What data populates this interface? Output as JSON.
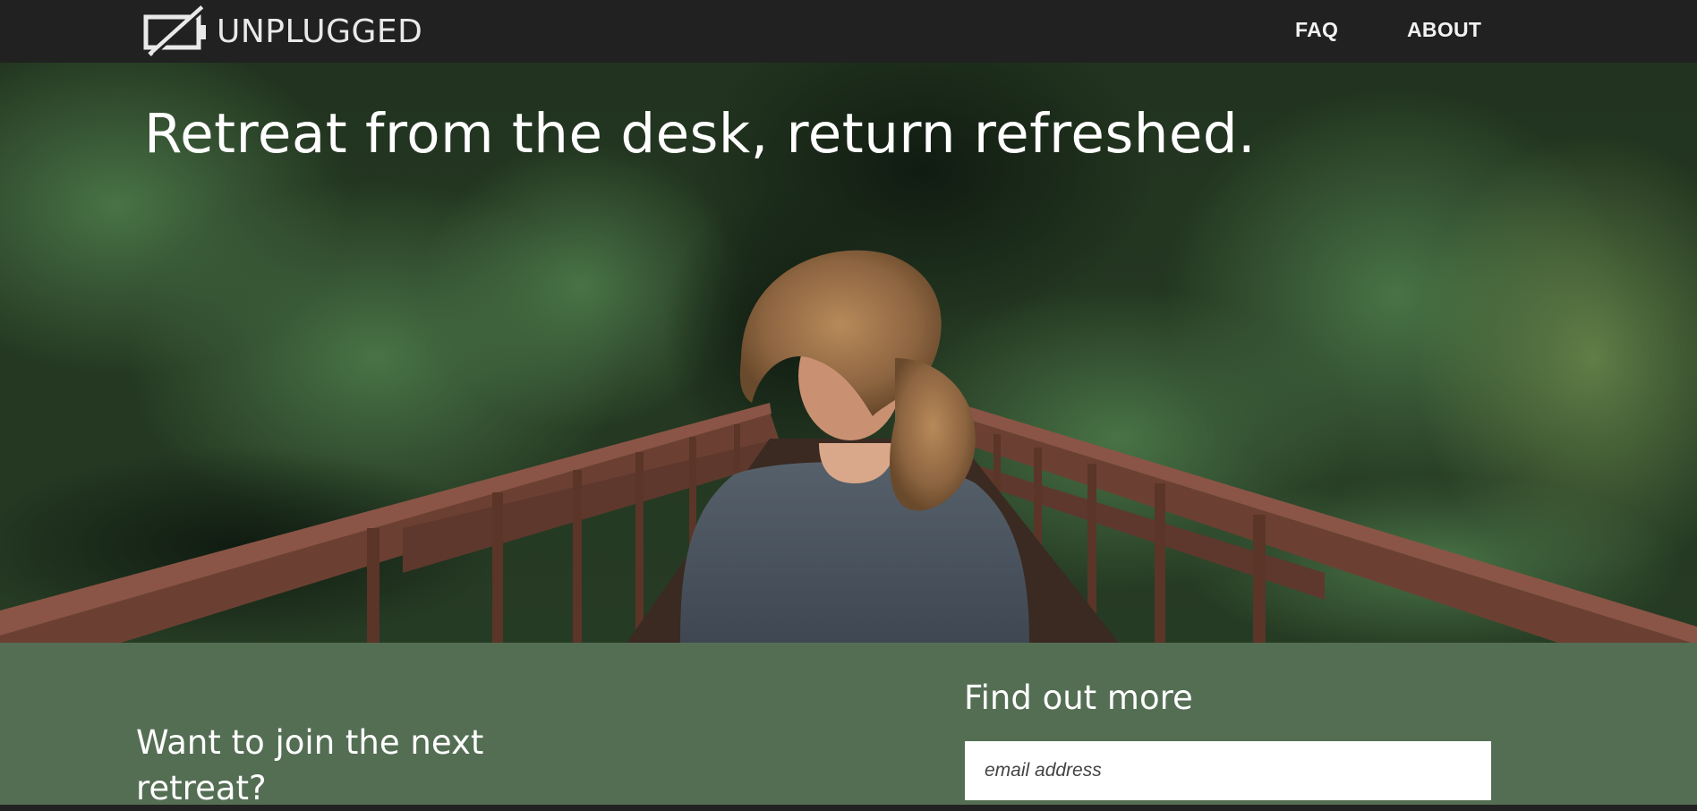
{
  "header": {
    "logo_text": "UNPLUGGED",
    "logo_icon": "battery-slash-icon",
    "nav": [
      {
        "label": "FAQ"
      },
      {
        "label": "ABOUT"
      }
    ]
  },
  "hero": {
    "title": "Retreat from the desk, return refreshed.",
    "image": "person-on-bridge-forest-image"
  },
  "signup": {
    "prompt": "Want to join the next retreat?",
    "find_title": "Find out more",
    "email_placeholder": "email address"
  },
  "colors": {
    "header_bg": "#212121",
    "section_bg": "#546e54",
    "text_light": "#ffffff"
  }
}
